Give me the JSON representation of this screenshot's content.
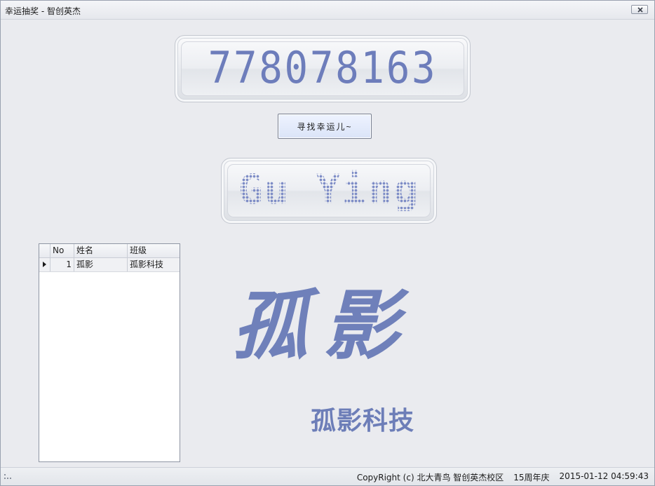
{
  "window": {
    "title": "幸运抽奖 - 智创英杰"
  },
  "lottery": {
    "number_display": "778078163",
    "find_button_label": "寻找幸运儿~",
    "winner_name": "Gu Ying"
  },
  "grid": {
    "columns": [
      "No",
      "姓名",
      "班级"
    ],
    "rows": [
      {
        "no": "1",
        "name": "孤影",
        "class": "孤影科技"
      }
    ]
  },
  "brand": {
    "calligraphy": "孤影",
    "subtitle": "孤影科技"
  },
  "status": {
    "copyright": "CopyRight (c) 北大青鸟 智创英杰校区",
    "anniversary": "15周年庆",
    "datetime": "2015-01-12 04:59:43"
  },
  "colors": {
    "accent": "#6d7eb8",
    "window_bg": "#eaebef"
  },
  "icons": {
    "close": "close-icon",
    "row_indicator": "row-pointer-icon",
    "size_grip": "resize-grip-icon"
  }
}
